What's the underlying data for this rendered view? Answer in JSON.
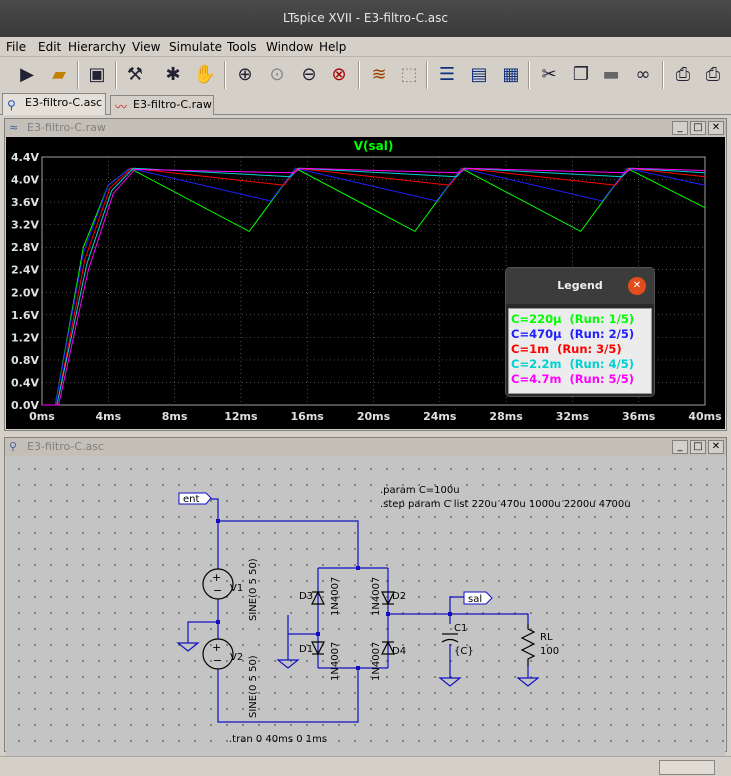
{
  "window": {
    "title": "LTspice XVII - E3-filtro-C.asc"
  },
  "menu": [
    "File",
    "Edit",
    "Hierarchy",
    "View",
    "Simulate",
    "Tools",
    "Window",
    "Help"
  ],
  "tabs": [
    {
      "label": "E3-filtro-C.asc",
      "icon": "schematic-icon"
    },
    {
      "label": "E3-filtro-C.raw",
      "icon": "waveform-icon"
    }
  ],
  "plot_window": {
    "title": "E3-filtro-C.raw",
    "trace_title": "V(sal)"
  },
  "schematic_window": {
    "title": "E3-filtro-C.asc"
  },
  "legend": {
    "title": "Legend",
    "entries": [
      {
        "label": "C=220µ",
        "run": "(Run: 1/5)",
        "color": "#00ff00"
      },
      {
        "label": "C=470µ",
        "run": "(Run: 2/5)",
        "color": "#2020ff"
      },
      {
        "label": "C=1m",
        "run": "(Run: 3/5)",
        "color": "#ff0000"
      },
      {
        "label": "C=2.2m",
        "run": "(Run: 4/5)",
        "color": "#00d0d0"
      },
      {
        "label": "C=4.7m",
        "run": "(Run: 5/5)",
        "color": "#ff00ff"
      }
    ]
  },
  "chart_data": {
    "type": "line",
    "title": "V(sal)",
    "xlim": [
      0,
      40
    ],
    "ylim": [
      0,
      4.4
    ],
    "x_ticks": [
      "0ms",
      "4ms",
      "8ms",
      "12ms",
      "16ms",
      "20ms",
      "24ms",
      "28ms",
      "32ms",
      "36ms",
      "40ms"
    ],
    "y_ticks": [
      "0.0V",
      "0.4V",
      "0.8V",
      "1.2V",
      "1.6V",
      "2.0V",
      "2.4V",
      "2.8V",
      "3.2V",
      "3.6V",
      "4.0V",
      "4.4V"
    ],
    "series": [
      {
        "name": "C=220µ",
        "color": "#00ff00",
        "x": [
          0,
          0.8,
          2.5,
          4.0,
          5.3,
          12.5,
          15.3,
          22.5,
          25.3,
          32.5,
          35.3,
          40
        ],
        "y": [
          0,
          0,
          2.8,
          3.9,
          4.2,
          3.08,
          4.2,
          3.08,
          4.2,
          3.08,
          4.2,
          3.5
        ]
      },
      {
        "name": "C=470µ",
        "color": "#2020ff",
        "x": [
          0,
          0.8,
          2.5,
          4.0,
          5.3,
          13.8,
          15.3,
          23.8,
          25.3,
          33.8,
          35.3,
          40
        ],
        "y": [
          0,
          0,
          2.7,
          3.9,
          4.2,
          3.62,
          4.2,
          3.62,
          4.2,
          3.62,
          4.2,
          3.9
        ]
      },
      {
        "name": "C=1m",
        "color": "#ff0000",
        "x": [
          0,
          0.9,
          2.6,
          4.1,
          5.4,
          14.6,
          15.4,
          24.6,
          25.4,
          34.6,
          35.4,
          40
        ],
        "y": [
          0,
          0,
          2.6,
          3.85,
          4.2,
          3.9,
          4.2,
          3.9,
          4.2,
          3.9,
          4.2,
          4.05
        ]
      },
      {
        "name": "C=2.2m",
        "color": "#00d0d0",
        "x": [
          0,
          0.9,
          2.7,
          4.2,
          5.5,
          15.0,
          15.5,
          25.0,
          25.5,
          35.0,
          35.5,
          40
        ],
        "y": [
          0,
          0,
          2.5,
          3.8,
          4.2,
          4.05,
          4.2,
          4.05,
          4.2,
          4.05,
          4.2,
          4.12
        ]
      },
      {
        "name": "C=4.7m",
        "color": "#ff00ff",
        "x": [
          0,
          1.0,
          2.8,
          4.3,
          5.6,
          15.2,
          15.6,
          25.2,
          25.6,
          35.2,
          35.6,
          40
        ],
        "y": [
          0,
          0,
          2.4,
          3.75,
          4.18,
          4.12,
          4.2,
          4.12,
          4.2,
          4.12,
          4.2,
          4.16
        ]
      }
    ]
  },
  "schematic": {
    "labels": {
      "ent": "ent",
      "sal": "sal",
      "V1": "V1",
      "V2": "V2",
      "V1_value": "SINE(0 5 50)",
      "V2_value": "SINE(0 5 50)",
      "D1": "D1",
      "D2": "D2",
      "D3": "D3",
      "D4": "D4",
      "diode_model": "1N4007",
      "C1": "C1",
      "C1_value": "{C}",
      "RL": "RL",
      "RL_value": "100"
    },
    "directives": [
      ".param C=100u",
      ".step param C list 220u 470u 1000u 2200u 4700u",
      ".tran 0 40ms 0 1ms"
    ]
  }
}
